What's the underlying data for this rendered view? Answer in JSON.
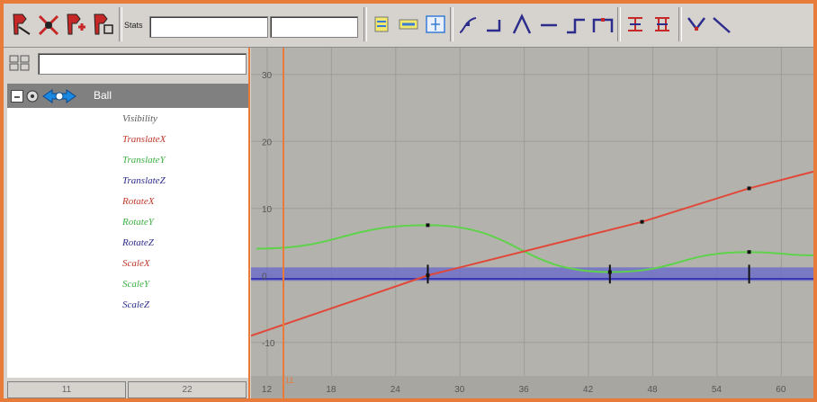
{
  "toolbar": {
    "stats_label": "Stats",
    "stats_value_1": "",
    "stats_value_2": "",
    "tools": [
      {
        "icon": "move-nearest-picked-key-icon"
      },
      {
        "icon": "insert-keys-icon"
      },
      {
        "icon": "add-keys-icon"
      },
      {
        "icon": "lattice-deform-keys-icon"
      },
      {
        "icon": "frame-all-icon"
      },
      {
        "icon": "frame-playback-range-icon"
      },
      {
        "icon": "center-current-time-icon"
      },
      {
        "icon": "spline-tangents-icon"
      },
      {
        "icon": "clamped-tangents-icon"
      },
      {
        "icon": "linear-tangents-icon"
      },
      {
        "icon": "flat-tangents-icon"
      },
      {
        "icon": "step-tangents-icon"
      },
      {
        "icon": "plateau-tangents-icon"
      },
      {
        "icon": "buffer-curve-snapshot-icon"
      },
      {
        "icon": "swap-buffer-curves-icon"
      },
      {
        "icon": "break-tangents-icon"
      },
      {
        "icon": "unify-tangents-icon"
      }
    ]
  },
  "outliner": {
    "filter_value": "",
    "node_label": "Ball",
    "attributes": [
      {
        "label": "Visibility",
        "color": "#5a5a5a"
      },
      {
        "label": "TranslateX",
        "color": "#c0392b"
      },
      {
        "label": "TranslateY",
        "color": "#3cb043"
      },
      {
        "label": "TranslateZ",
        "color": "#2c2c8c"
      },
      {
        "label": "RotateX",
        "color": "#c0392b"
      },
      {
        "label": "RotateY",
        "color": "#3cb043"
      },
      {
        "label": "RotateZ",
        "color": "#2c2c8c"
      },
      {
        "label": "ScaleX",
        "color": "#c0392b"
      },
      {
        "label": "ScaleY",
        "color": "#3cb043"
      },
      {
        "label": "ScaleZ",
        "color": "#2c2c8c"
      }
    ],
    "frame_boxes": [
      "11",
      "22"
    ]
  },
  "graph": {
    "current_frame": "11",
    "y_ticks": [
      30,
      20,
      10,
      0,
      -10
    ],
    "x_ticks": [
      12,
      18,
      24,
      30,
      36,
      42,
      48,
      54,
      60
    ],
    "x_range": [
      11,
      63
    ],
    "y_range": [
      -15,
      34
    ],
    "colors": {
      "bg": "#b4b2ad",
      "grid": "#9e9c98",
      "red": "#e0493a",
      "green": "#5ed24a",
      "blue": "#3a3ab0",
      "time": "#e87a3a"
    },
    "curves": {
      "translate_x": [
        [
          5,
          -12
        ],
        [
          27,
          0
        ],
        [
          47,
          8
        ],
        [
          57,
          13
        ],
        [
          63,
          15.5
        ]
      ],
      "translate_y": [
        [
          11,
          4
        ],
        [
          27,
          7.5
        ],
        [
          44,
          0.5
        ],
        [
          57,
          3.5
        ],
        [
          63,
          3
        ]
      ],
      "flat_keys": [
        27,
        44,
        57
      ]
    }
  }
}
